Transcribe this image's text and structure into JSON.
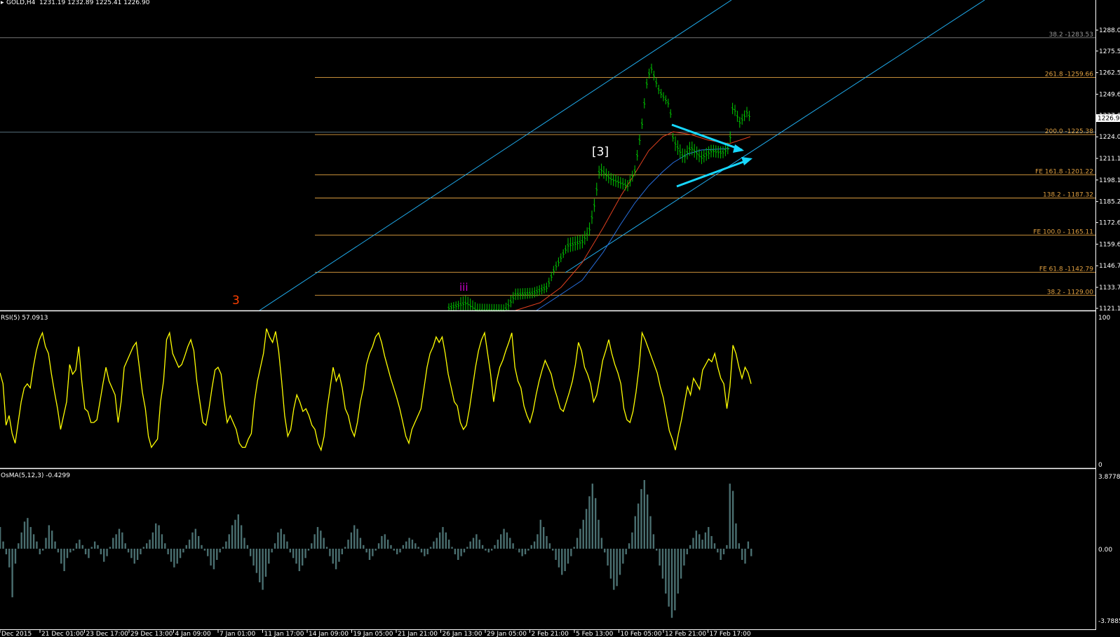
{
  "header": {
    "symbol_label": "GOLD,H4",
    "ohlc": "1231.19 1232.89 1225.41 1226.90"
  },
  "colors": {
    "background": "#000000",
    "candle": "#00c800",
    "fib": "#e0a040",
    "channel": "#1fa8e8",
    "ma_red": "#e04020",
    "ma_blue": "#2870e0",
    "rsi": "#ffff00",
    "osma": "#4a6f70",
    "arrow": "#17d8ff",
    "wave_orange": "#ff4000",
    "wave_purple": "#cc00cc",
    "wave_white": "#ffffff"
  },
  "price_axis": {
    "ticks": [
      "1288.06",
      "1275.51",
      "1262.56",
      "1249.61",
      "1237.01",
      "1224.06",
      "1211.11",
      "1198.16",
      "1185.21",
      "1172.61",
      "1159.66",
      "1146.71",
      "1133.76",
      "1121.16"
    ],
    "current_price": "1226.90"
  },
  "fib_levels": [
    {
      "label": "38.2 -1283.53",
      "price": 1283.53
    },
    {
      "label": "261.8 -1259.66",
      "price": 1259.66
    },
    {
      "label": "200.0 -1225.38",
      "price": 1225.38
    },
    {
      "label": "FE 161.8 -1201.22",
      "price": 1201.22
    },
    {
      "label": "138.2 - 1187.32",
      "price": 1187.32
    },
    {
      "label": "FE 100.0 - 1165.11",
      "price": 1165.11
    },
    {
      "label": "FE 61.8 -1142.79",
      "price": 1142.79
    },
    {
      "label": "38.2 - 1129.00",
      "price": 1129.0
    }
  ],
  "wave_labels": [
    {
      "text": "3",
      "color": "wave_orange"
    },
    {
      "text": "iii",
      "color": "wave_purple"
    },
    {
      "text": "[3]",
      "color": "wave_white"
    }
  ],
  "rsi": {
    "label": "RSI(5) 57.0913",
    "axis_top": "100",
    "axis_bottom": "0",
    "values": [
      66,
      58,
      28,
      35,
      22,
      15,
      30,
      45,
      55,
      58,
      55,
      70,
      82,
      90,
      95,
      85,
      80,
      65,
      52,
      40,
      25,
      35,
      45,
      72,
      65,
      68,
      85,
      60,
      40,
      38,
      30,
      30,
      32,
      45,
      58,
      70,
      60,
      55,
      50,
      30,
      45,
      70,
      75,
      80,
      85,
      88,
      70,
      52,
      40,
      20,
      12,
      15,
      18,
      45,
      60,
      90,
      95,
      80,
      75,
      70,
      72,
      78,
      85,
      90,
      82,
      60,
      45,
      30,
      28,
      40,
      55,
      68,
      70,
      65,
      45,
      30,
      35,
      30,
      25,
      15,
      12,
      12,
      18,
      22,
      45,
      60,
      70,
      80,
      98,
      92,
      88,
      96,
      82,
      60,
      35,
      20,
      25,
      40,
      50,
      45,
      38,
      40,
      35,
      28,
      25,
      15,
      10,
      20,
      40,
      55,
      70,
      60,
      65,
      55,
      40,
      35,
      25,
      20,
      30,
      45,
      55,
      72,
      80,
      85,
      92,
      95,
      88,
      78,
      70,
      62,
      55,
      48,
      40,
      30,
      20,
      15,
      25,
      30,
      35,
      40,
      55,
      70,
      80,
      85,
      92,
      88,
      92,
      80,
      65,
      55,
      45,
      42,
      30,
      25,
      28,
      40,
      55,
      70,
      82,
      90,
      95,
      80,
      65,
      45,
      60,
      70,
      75,
      82,
      88,
      95,
      70,
      60,
      55,
      42,
      35,
      30,
      38,
      50,
      60,
      68,
      75,
      70,
      65,
      55,
      48,
      40,
      38,
      45,
      52,
      60,
      72,
      88,
      82,
      70,
      65,
      58,
      45,
      50,
      62,
      75,
      82,
      90,
      80,
      72,
      66,
      58,
      40,
      32,
      30,
      38,
      52,
      70,
      95,
      90,
      84,
      78,
      72,
      66,
      56,
      48,
      36,
      24,
      18,
      10,
      22,
      32,
      44,
      56,
      50,
      62,
      58,
      54,
      68,
      72,
      76,
      74,
      80,
      70,
      62,
      58,
      40,
      56,
      86,
      80,
      70,
      62,
      70,
      66,
      58
    ],
    "last": 57.09
  },
  "osma": {
    "label": "OsMA(5,12,3) -0.4299",
    "axis_top": "3.8778",
    "axis_zero": "0.00",
    "axis_bottom": "-3.7885",
    "max": 3.8778,
    "min": -3.7885,
    "values": [
      1.2,
      0.4,
      -0.3,
      -1.0,
      -2.6,
      -0.8,
      0.3,
      0.9,
      1.5,
      1.7,
      1.2,
      0.8,
      0.4,
      -0.3,
      -0.1,
      0.6,
      1.3,
      1.0,
      0.4,
      -0.2,
      -0.8,
      -1.2,
      -0.5,
      -0.2,
      -0.1,
      0.3,
      0.5,
      0.2,
      -0.3,
      -0.5,
      0.1,
      0.4,
      0.2,
      -0.3,
      -0.7,
      -0.4,
      0.1,
      0.6,
      0.8,
      1.1,
      0.9,
      0.3,
      -0.2,
      -0.5,
      -0.8,
      -0.6,
      -0.3,
      0.1,
      0.3,
      0.5,
      0.9,
      1.4,
      1.3,
      0.8,
      0.3,
      -0.3,
      -0.7,
      -1.0,
      -0.8,
      -0.5,
      -0.2,
      0.2,
      0.5,
      0.9,
      1.1,
      0.7,
      0.2,
      -0.1,
      -0.4,
      -0.9,
      -1.1,
      -0.6,
      -0.2,
      0.1,
      0.4,
      0.8,
      1.3,
      1.6,
      1.9,
      1.3,
      0.6,
      0.2,
      -0.4,
      -0.9,
      -1.3,
      -1.8,
      -2.2,
      -1.5,
      -0.8,
      -0.2,
      0.3,
      0.9,
      1.1,
      0.8,
      0.4,
      -0.2,
      -0.5,
      -0.8,
      -1.2,
      -0.9,
      -0.5,
      -0.1,
      0.3,
      0.8,
      1.2,
      1.0,
      0.6,
      0.1,
      -0.4,
      -0.8,
      -1.1,
      -0.7,
      -0.3,
      0.1,
      0.5,
      0.9,
      1.3,
      1.1,
      0.6,
      0.2,
      -0.2,
      -0.6,
      -0.4,
      -0.1,
      0.3,
      0.7,
      0.8,
      0.5,
      0.2,
      -0.1,
      -0.3,
      -0.2,
      0.2,
      0.4,
      0.6,
      0.5,
      0.3,
      0.1,
      -0.2,
      -0.4,
      -0.3,
      0.1,
      0.4,
      0.6,
      0.9,
      1.2,
      0.9,
      0.5,
      0.1,
      -0.3,
      -0.6,
      -0.4,
      -0.2,
      0.1,
      0.4,
      0.6,
      0.8,
      0.5,
      0.2,
      -0.1,
      -0.2,
      -0.1,
      0.2,
      0.5,
      0.8,
      1.1,
      0.9,
      0.6,
      0.3,
      0.0,
      -0.2,
      -0.4,
      -0.3,
      -0.1,
      0.2,
      0.4,
      0.8,
      1.6,
      1.2,
      0.7,
      0.3,
      -0.1,
      -0.6,
      -1.0,
      -1.4,
      -1.2,
      -0.8,
      -0.4,
      0.1,
      0.6,
      1.1,
      1.6,
      2.2,
      2.9,
      3.6,
      2.8,
      1.6,
      0.6,
      -0.2,
      -0.9,
      -1.6,
      -2.2,
      -2.0,
      -1.4,
      -0.8,
      -0.3,
      0.3,
      0.9,
      1.8,
      2.5,
      3.3,
      3.8,
      3.0,
      1.8,
      0.8,
      -0.1,
      -0.9,
      -1.6,
      -2.4,
      -3.1,
      -3.7,
      -3.3,
      -2.4,
      -1.6,
      -0.9,
      -0.3,
      0.2,
      0.6,
      1.0,
      0.8,
      0.5,
      0.9,
      1.2,
      0.7,
      0.3,
      -0.2,
      -0.6,
      -0.3,
      0.2,
      3.6,
      3.2,
      1.4,
      0.3,
      -0.6,
      -0.8,
      0.4,
      -0.4
    ]
  },
  "time_axis": {
    "labels": [
      "Dec 2015",
      "21 Dec 01:00",
      "23 Dec 17:00",
      "29 Dec 13:00",
      "4 Jan 09:00",
      "7 Jan 01:00",
      "11 Jan 17:00",
      "14 Jan 09:00",
      "19 Jan 05:00",
      "21 Jan 21:00",
      "26 Jan 13:00",
      "29 Jan 05:00",
      "2 Feb 21:00",
      "5 Feb 13:00",
      "10 Feb 05:00",
      "12 Feb 21:00",
      "17 Feb 17:00"
    ]
  }
}
